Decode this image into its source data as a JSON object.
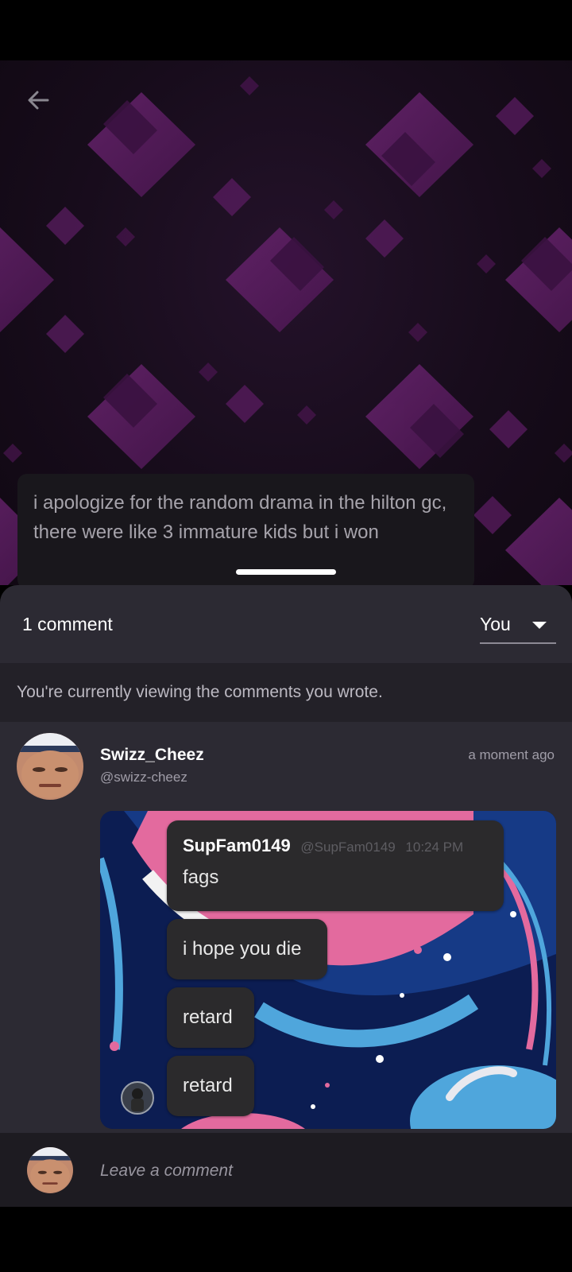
{
  "post": {
    "caption": "i apologize for the random drama in the hilton gc, there were like 3 immature kids but i won"
  },
  "comments_header": {
    "count_label": "1 comment",
    "filter_selected": "You"
  },
  "filter_notice": "You're currently viewing the comments you wrote.",
  "comments": [
    {
      "author": "Swizz_Cheez",
      "handle": "@swizz-cheez",
      "time": "a moment ago",
      "attachment": {
        "header_user": "SupFam0149",
        "header_handle": "@SupFam0149",
        "header_time": "10:24 PM",
        "messages": [
          "fags",
          "i hope you die",
          "retard",
          "retard"
        ]
      }
    }
  ],
  "composer": {
    "placeholder": "Leave a comment"
  },
  "colors": {
    "accent_purple": "#7a2a7c",
    "sheet_bg": "#2c2a33",
    "composer_bg": "#1d1b21"
  },
  "icons": {
    "back": "arrow-left-icon",
    "dropdown": "caret-down-icon"
  }
}
